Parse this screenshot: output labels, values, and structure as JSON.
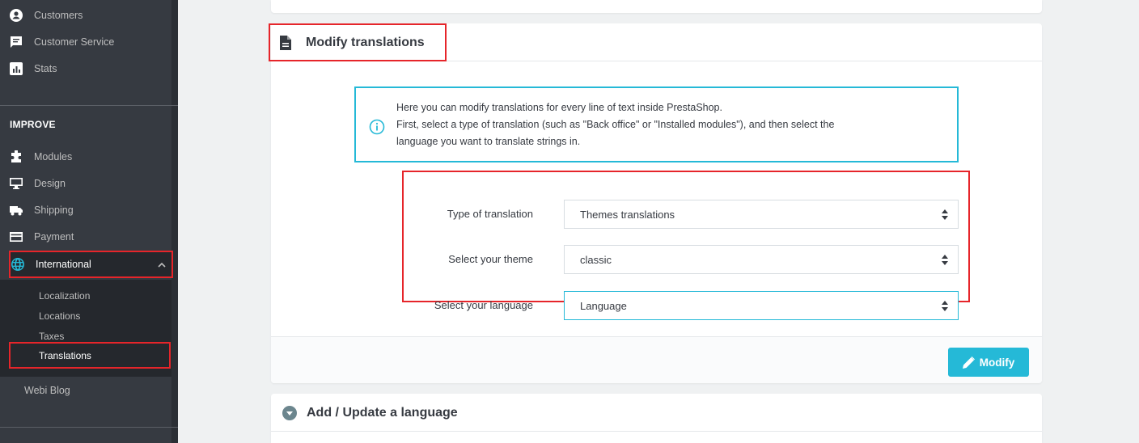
{
  "sidebar": {
    "top_items": [
      {
        "label": "Customers",
        "icon": "account-circle-icon"
      },
      {
        "label": "Customer Service",
        "icon": "chat-icon"
      },
      {
        "label": "Stats",
        "icon": "stats-icon"
      }
    ],
    "section_title": "IMPROVE",
    "improve_items": [
      {
        "label": "Modules",
        "icon": "puzzle-icon"
      },
      {
        "label": "Design",
        "icon": "desktop-icon"
      },
      {
        "label": "Shipping",
        "icon": "truck-icon"
      },
      {
        "label": "Payment",
        "icon": "credit-card-icon"
      }
    ],
    "active_item": {
      "label": "International",
      "icon": "globe-icon"
    },
    "submenu": [
      "Localization",
      "Locations",
      "Taxes",
      "Translations"
    ],
    "extra_item": "Webi Blog"
  },
  "panel": {
    "title": "Modify translations",
    "info_lines": [
      "Here you can modify translations for every line of text inside PrestaShop.",
      "First, select a type of translation (such as \"Back office\" or \"Installed modules\"), and then select the",
      "language you want to translate strings in."
    ],
    "form": {
      "type_label": "Type of translation",
      "type_value": "Themes translations",
      "theme_label": "Select your theme",
      "theme_value": "classic",
      "language_label": "Select your language",
      "language_value": "Language"
    },
    "modify_button": "Modify"
  },
  "panel2": {
    "title": "Add / Update a language"
  },
  "colors": {
    "accent": "#25b9d7",
    "highlight": "#e6252a",
    "sidebar_bg": "#363a41"
  }
}
